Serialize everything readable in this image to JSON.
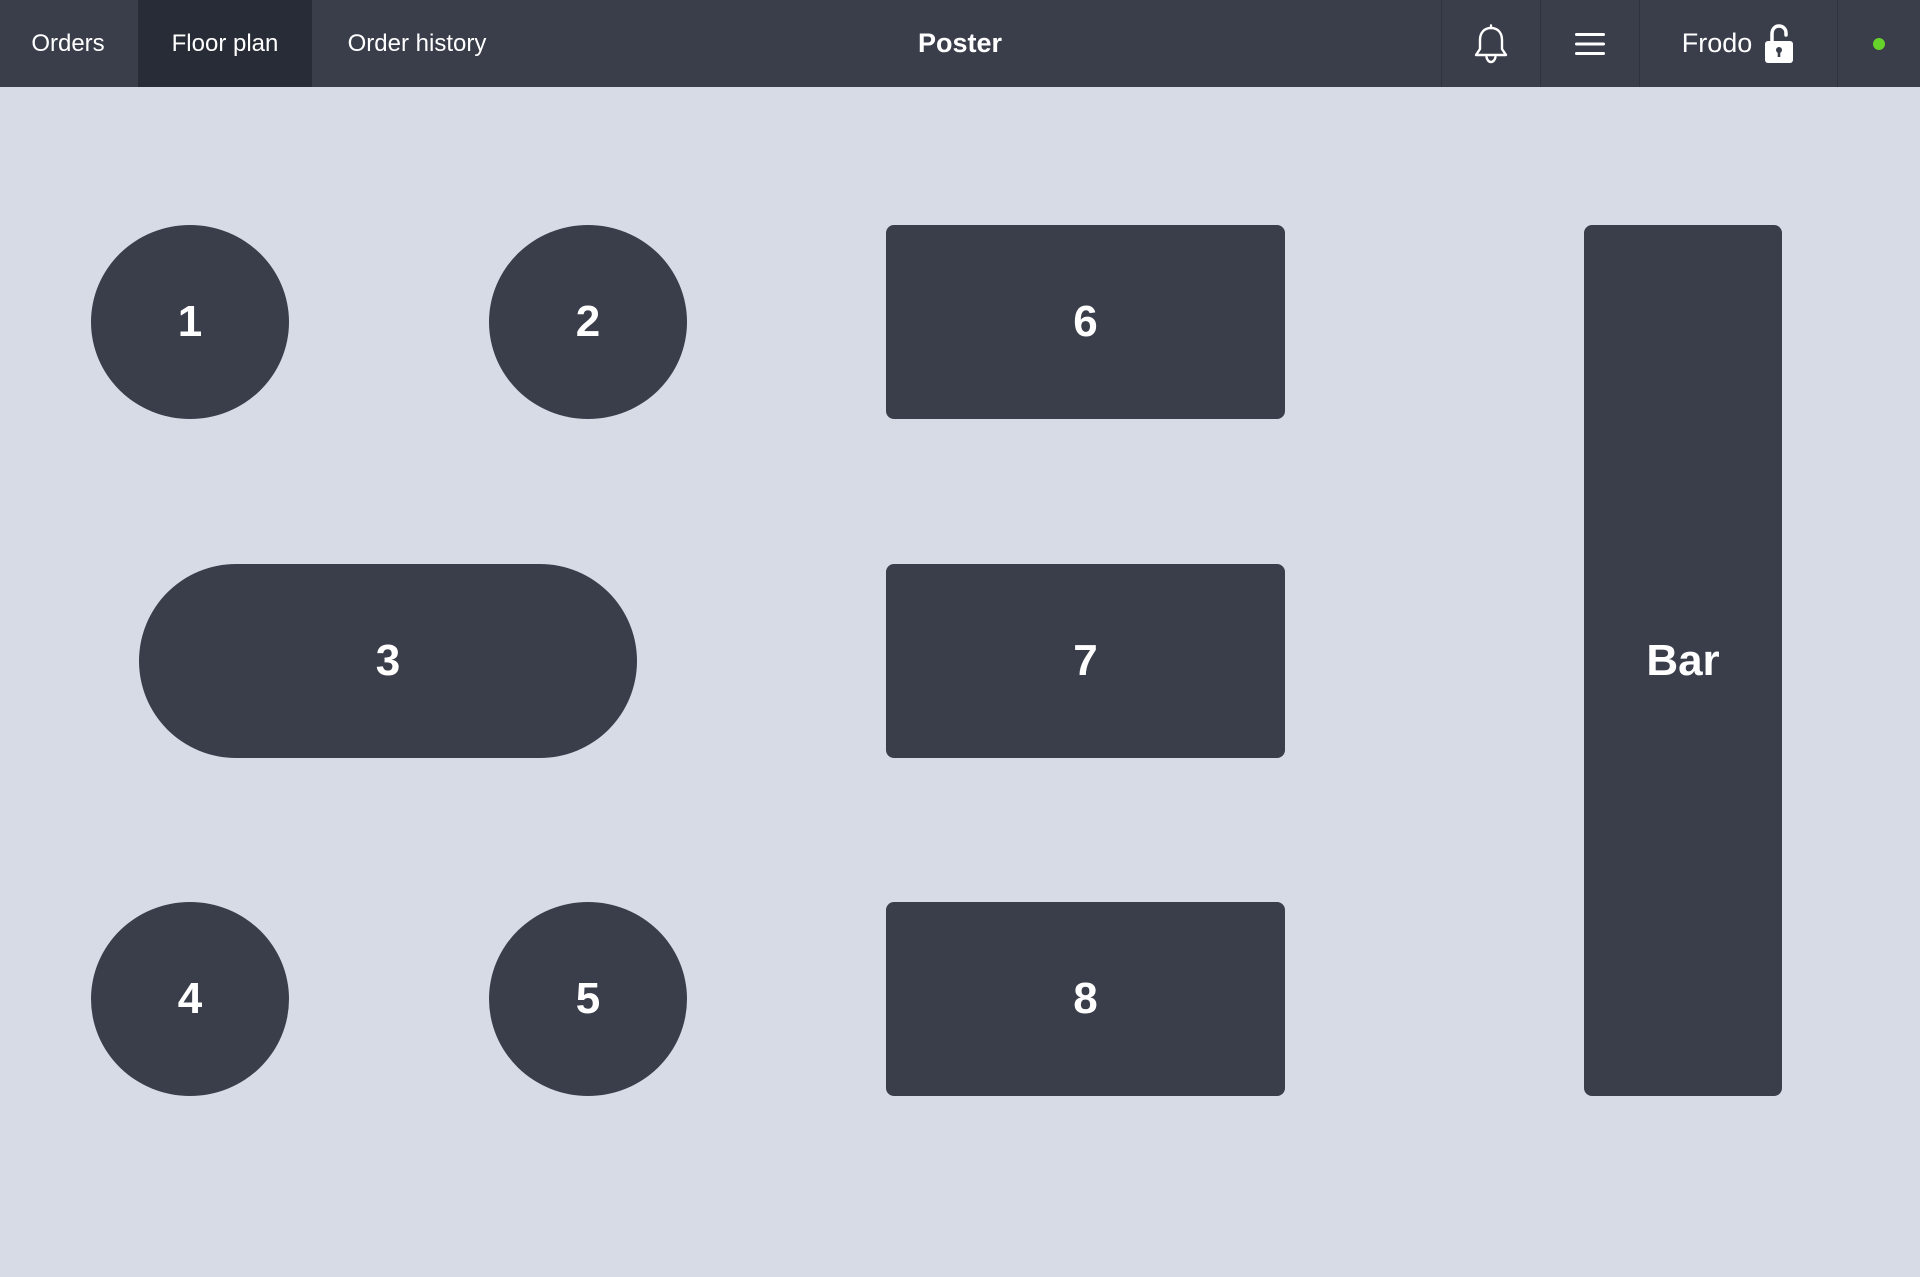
{
  "header": {
    "tabs": [
      {
        "label": "Orders",
        "active": false
      },
      {
        "label": "Floor plan",
        "active": true
      },
      {
        "label": "Order history",
        "active": false
      }
    ],
    "title": "Poster",
    "user_name": "Frodo",
    "icons": {
      "notifications": "bell-icon",
      "menu": "hamburger-menu-icon",
      "lock": "unlocked-padlock-icon",
      "status": "status-dot"
    },
    "status_color": "#66d32a"
  },
  "floor_plan": {
    "tables": [
      {
        "label": "1",
        "shape": "round"
      },
      {
        "label": "2",
        "shape": "round"
      },
      {
        "label": "3",
        "shape": "pill"
      },
      {
        "label": "4",
        "shape": "round"
      },
      {
        "label": "5",
        "shape": "round"
      },
      {
        "label": "6",
        "shape": "rectangle"
      },
      {
        "label": "7",
        "shape": "rectangle"
      },
      {
        "label": "8",
        "shape": "rectangle"
      },
      {
        "label": "Bar",
        "shape": "rectangle"
      }
    ]
  },
  "colors": {
    "topbar": "#3a3e4b",
    "active_tab": "#282c36",
    "floor_background": "#d7dbe6",
    "table_fill": "#3a3e4b",
    "table_text": "#ffffff"
  }
}
